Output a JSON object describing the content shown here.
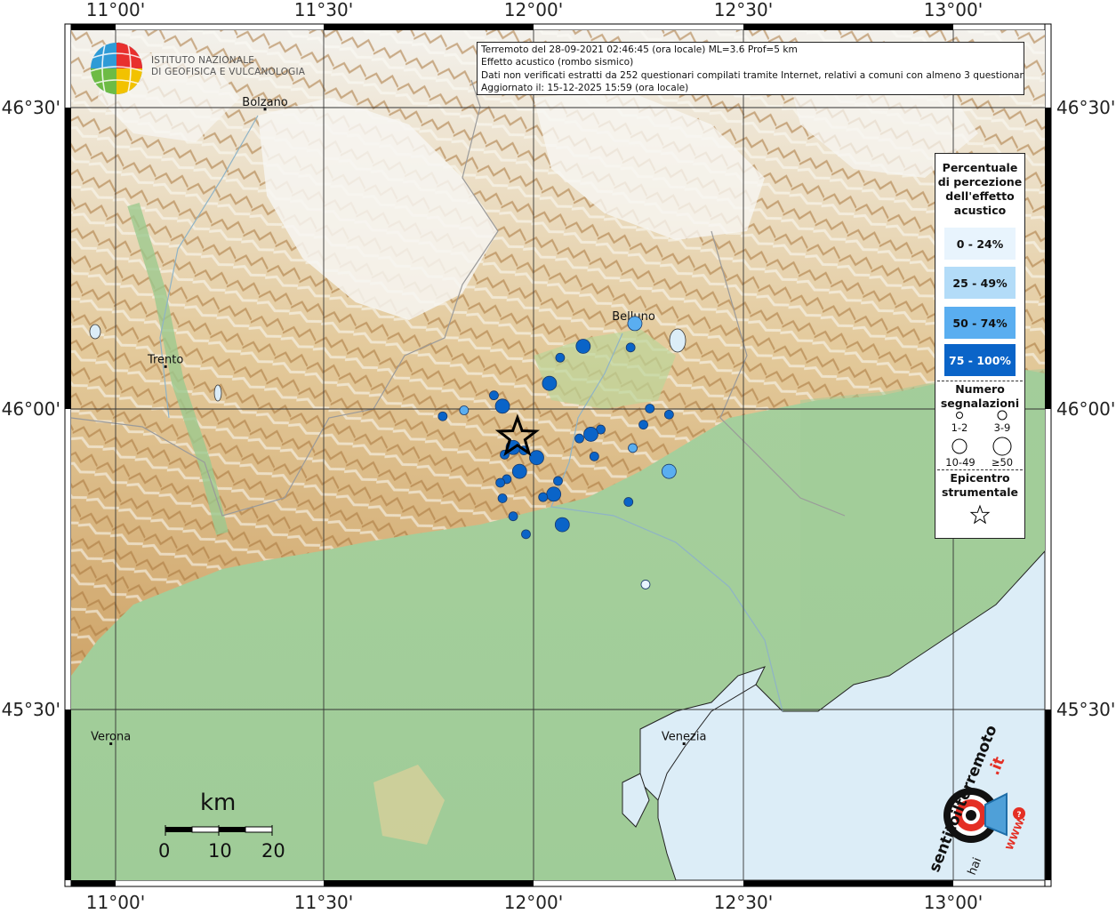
{
  "header": {
    "line1": "Terremoto del 28-09-2021 02:46:45 (ora locale) ML=3.6 Prof=5 km",
    "line2": "Effetto acustico (rombo sismico)",
    "line3": "Dati non verificati estratti da 252 questionari compilati tramite Internet, relativi a comuni con almeno 3 questionari.",
    "line4": "Aggiornato il: 15-12-2025 15:59 (ora locale)"
  },
  "logo": {
    "ingv_line1": "ISTITUTO NAZIONALE",
    "ingv_line2": "DI GEOFISICA E VULCANOLOGIA",
    "hst_main": "sentitoilterremoto",
    "hst_hai": "hai",
    "hst_it": ".it",
    "hst_www": "WWW."
  },
  "axes": {
    "x_labels": [
      "11°00'",
      "11°30'",
      "12°00'",
      "12°30'",
      "13°00'"
    ],
    "y_labels": [
      "46°30'",
      "46°00'",
      "45°30'"
    ]
  },
  "cities": [
    {
      "name": "Bolzano",
      "lon": 11.354,
      "lat": 46.498
    },
    {
      "name": "Trento",
      "lon": 11.121,
      "lat": 46.068
    },
    {
      "name": "Belluno",
      "lon": 12.217,
      "lat": 46.14
    },
    {
      "name": "Verona",
      "lon": 10.993,
      "lat": 45.438
    },
    {
      "name": "Venezia",
      "lon": 12.335,
      "lat": 45.438
    }
  ],
  "epicenter": {
    "lon": 11.945,
    "lat": 45.95
  },
  "legend": {
    "title": [
      "Percentuale",
      "di percezione",
      "dell'effetto",
      "acustico"
    ],
    "classes": [
      {
        "label": "0 - 24%",
        "color": "#e8f4fd"
      },
      {
        "label": "25 - 49%",
        "color": "#b3dcf8"
      },
      {
        "label": "50 - 74%",
        "color": "#5aaef0"
      },
      {
        "label": "75 - 100%",
        "color": "#0a64c8"
      }
    ],
    "count_title": [
      "Numero",
      "segnalazioni"
    ],
    "sizes": [
      "1-2",
      "3-9",
      "10-49",
      "≥50"
    ],
    "epi_title": [
      "Epicentro",
      "strumentale"
    ]
  },
  "scale": {
    "unit": "km",
    "ticks": [
      "0",
      "10",
      "20"
    ]
  },
  "map_data": {
    "extent": {
      "lon_min": 10.9,
      "lon_max": 13.18,
      "lat_min": 45.21,
      "lat_max": 46.63
    },
    "points": [
      {
        "lon": 12.099,
        "lat": 46.102,
        "cls": 3,
        "size": 2
      },
      {
        "lon": 12.045,
        "lat": 46.083,
        "cls": 3,
        "size": 1
      },
      {
        "lon": 12.21,
        "lat": 46.1,
        "cls": 3,
        "size": 1
      },
      {
        "lon": 12.22,
        "lat": 46.14,
        "cls": 2,
        "size": 2
      },
      {
        "lon": 12.02,
        "lat": 46.04,
        "cls": 3,
        "size": 2
      },
      {
        "lon": 11.89,
        "lat": 46.02,
        "cls": 3,
        "size": 1
      },
      {
        "lon": 11.91,
        "lat": 46.002,
        "cls": 3,
        "size": 2
      },
      {
        "lon": 11.82,
        "lat": 45.995,
        "cls": 2,
        "size": 1
      },
      {
        "lon": 11.77,
        "lat": 45.985,
        "cls": 3,
        "size": 1
      },
      {
        "lon": 12.255,
        "lat": 45.998,
        "cls": 3,
        "size": 1
      },
      {
        "lon": 12.3,
        "lat": 45.988,
        "cls": 3,
        "size": 1
      },
      {
        "lon": 12.14,
        "lat": 45.963,
        "cls": 3,
        "size": 1
      },
      {
        "lon": 12.117,
        "lat": 45.955,
        "cls": 3,
        "size": 2
      },
      {
        "lon": 12.24,
        "lat": 45.971,
        "cls": 3,
        "size": 1
      },
      {
        "lon": 12.09,
        "lat": 45.948,
        "cls": 3,
        "size": 1
      },
      {
        "lon": 11.935,
        "lat": 45.933,
        "cls": 3,
        "size": 2
      },
      {
        "lon": 11.96,
        "lat": 45.928,
        "cls": 3,
        "size": 1
      },
      {
        "lon": 11.915,
        "lat": 45.921,
        "cls": 3,
        "size": 1
      },
      {
        "lon": 11.99,
        "lat": 45.916,
        "cls": 3,
        "size": 2
      },
      {
        "lon": 12.215,
        "lat": 45.932,
        "cls": 2,
        "size": 1
      },
      {
        "lon": 12.125,
        "lat": 45.918,
        "cls": 3,
        "size": 1
      },
      {
        "lon": 12.3,
        "lat": 45.893,
        "cls": 2,
        "size": 2
      },
      {
        "lon": 11.95,
        "lat": 45.893,
        "cls": 3,
        "size": 2
      },
      {
        "lon": 11.92,
        "lat": 45.88,
        "cls": 3,
        "size": 1
      },
      {
        "lon": 11.905,
        "lat": 45.874,
        "cls": 3,
        "size": 1
      },
      {
        "lon": 12.04,
        "lat": 45.877,
        "cls": 3,
        "size": 1
      },
      {
        "lon": 12.03,
        "lat": 45.855,
        "cls": 3,
        "size": 2
      },
      {
        "lon": 12.005,
        "lat": 45.85,
        "cls": 3,
        "size": 1
      },
      {
        "lon": 11.91,
        "lat": 45.848,
        "cls": 3,
        "size": 1
      },
      {
        "lon": 12.205,
        "lat": 45.842,
        "cls": 3,
        "size": 1
      },
      {
        "lon": 11.935,
        "lat": 45.818,
        "cls": 3,
        "size": 1
      },
      {
        "lon": 12.05,
        "lat": 45.804,
        "cls": 3,
        "size": 2
      },
      {
        "lon": 11.965,
        "lat": 45.788,
        "cls": 3,
        "size": 1
      },
      {
        "lon": 12.245,
        "lat": 45.704,
        "cls": 0,
        "size": 1
      }
    ]
  }
}
